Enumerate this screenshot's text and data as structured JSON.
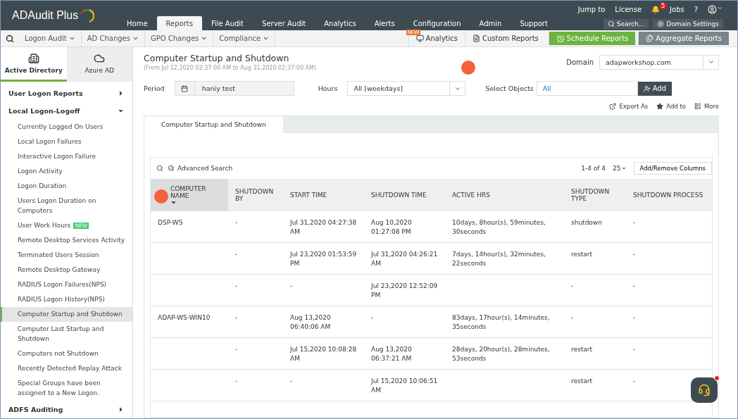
{
  "app": {
    "logo": "ADAudit Plus"
  },
  "top_links": [
    {
      "kind": "text",
      "label": "Jump to"
    },
    {
      "kind": "text",
      "label": "License"
    },
    {
      "kind": "bell",
      "badge": "5"
    },
    {
      "kind": "text",
      "label": "Jobs"
    },
    {
      "kind": "text",
      "label": "?"
    },
    {
      "kind": "user"
    }
  ],
  "main_tabs": [
    {
      "label": "Home",
      "selected": false
    },
    {
      "label": "Reports",
      "selected": true
    },
    {
      "label": "File Audit",
      "selected": false
    },
    {
      "label": "Server Audit",
      "selected": false
    },
    {
      "label": "Analytics",
      "selected": false
    },
    {
      "label": "Alerts",
      "selected": false
    },
    {
      "label": "Configuration",
      "selected": false
    },
    {
      "label": "Admin",
      "selected": false
    },
    {
      "label": "Support",
      "selected": false
    }
  ],
  "top_buttons": [
    {
      "kind": "search",
      "label": "Search..."
    },
    {
      "kind": "settings",
      "label": "Domain Settings"
    }
  ],
  "sub_menus": [
    "Logon Audit",
    "AD Changes",
    "GPO Changes",
    "Compliance"
  ],
  "sub_actions": [
    {
      "kind": "analytics",
      "label": "Analytics",
      "badge": "NEW"
    },
    {
      "kind": "custom",
      "label": "Custom Reports"
    },
    {
      "kind": "schedule",
      "label": "Schedule Reports"
    },
    {
      "kind": "aggregate",
      "label": "Aggregate Reports"
    }
  ],
  "source_tabs": [
    {
      "label": "Active Directory",
      "kind": "building",
      "selected": true
    },
    {
      "label": "Azure AD",
      "kind": "cloud",
      "selected": false
    }
  ],
  "sidebar": {
    "groups": [
      {
        "label": "User Logon Reports",
        "expanded": false
      },
      {
        "label": "Local Logon-Logoff",
        "expanded": true,
        "children": [
          {
            "label": "Currently Logged On Users",
            "selected": false
          },
          {
            "label": "Local Logon Failures",
            "selected": false
          },
          {
            "label": "Interactive Logon Failure",
            "selected": false
          },
          {
            "label": "Logon Activity",
            "selected": false
          },
          {
            "label": "Logon Duration",
            "selected": false
          },
          {
            "label": "Users Logon Duration on Computers",
            "selected": false
          },
          {
            "label": "User Work Hours",
            "badge": "NEW",
            "selected": false
          },
          {
            "label": "Remote Desktop Services Activity",
            "selected": false
          },
          {
            "label": "Terminated Users Session",
            "selected": false
          },
          {
            "label": "Remote Desktop Gateway",
            "selected": false
          },
          {
            "label": "RADIUS Logon Failures(NPS)",
            "selected": false
          },
          {
            "label": "RADIUS Logon History(NPS)",
            "selected": false
          },
          {
            "label": "Computer Startup and Shutdown",
            "selected": true
          },
          {
            "label": "Computer Last Startup and Shutdown",
            "selected": false
          },
          {
            "label": "Computers not Shutdown",
            "selected": false
          },
          {
            "label": "Recently Detected Replay Attack",
            "selected": false
          },
          {
            "label": "Special Groups have been assigned to a New Logon.",
            "selected": false
          }
        ]
      },
      {
        "label": "ADFS Auditing",
        "expanded": false
      }
    ]
  },
  "report": {
    "title": "Computer Startup and Shutdown",
    "subtitle": "(From Jul 12,2020 02:37:00 AM to Aug 31,2020 02:37:00 AM)",
    "domain_label": "Domain",
    "domain": "adapworkshop.com"
  },
  "filters": {
    "period_label": "Period",
    "period": "haniy test",
    "hours_label": "Hours",
    "hours": "All [weekdays]",
    "objects_label": "Select Objects",
    "objects": "All",
    "add": "Add"
  },
  "report_actions": [
    {
      "kind": "export",
      "label": "Export As"
    },
    {
      "kind": "star",
      "label": "Add to"
    },
    {
      "kind": "more",
      "label": "More"
    }
  ],
  "report_tab": "Computer Startup and Shutdown",
  "table_toolbar": {
    "advanced_search": "Advanced Search",
    "range": "1-4 of 4",
    "page_size": "25",
    "columns_button": "Add/Remove Columns"
  },
  "table": {
    "columns": [
      {
        "label": "COMPUTER NAME",
        "sorted": true
      },
      {
        "label": "SHUTDOWN BY",
        "sorted": false
      },
      {
        "label": "START TIME",
        "sorted": false
      },
      {
        "label": "SHUTDOWN TIME",
        "sorted": false
      },
      {
        "label": "ACTIVE HRS",
        "sorted": false
      },
      {
        "label": "SHUTDOWN TYPE",
        "sorted": false
      },
      {
        "label": "SHUTDOWN PROCESS",
        "sorted": false
      }
    ],
    "rows": [
      [
        "DSP-WS",
        "-",
        "Jul 31,2020 04:27:38 AM",
        "Aug 10,2020 01:27:08 PM",
        "10days, 8hour(s), 59minutes, 30seconds",
        "shutdown",
        "-"
      ],
      [
        "",
        "-",
        "Jul 23,2020 01:53:59 PM",
        "Jul 31,2020 04:26:21 AM",
        "7days, 14hour(s), 32minutes, 22seconds",
        "restart",
        "-"
      ],
      [
        "",
        "-",
        "-",
        "Jul 23,2020 12:52:09 PM",
        "",
        "-",
        "-"
      ],
      [
        "ADAP-WS-WIN10",
        "-",
        "Aug 13,2020 06:40:06 AM",
        "-",
        "83days, 17hour(s), 14minutes, 35seconds",
        "-",
        "-"
      ],
      [
        "",
        "-",
        "Jul 15,2020 10:08:28 AM",
        "Aug 13,2020 06:37:21 AM",
        "28days, 20hour(s), 28minutes, 53seconds",
        "restart",
        "-"
      ],
      [
        "",
        "-",
        "-",
        "Jul 15,2020 10:06:51 AM",
        "",
        "restart",
        "-"
      ]
    ]
  },
  "chat": {
    "notification": true
  }
}
